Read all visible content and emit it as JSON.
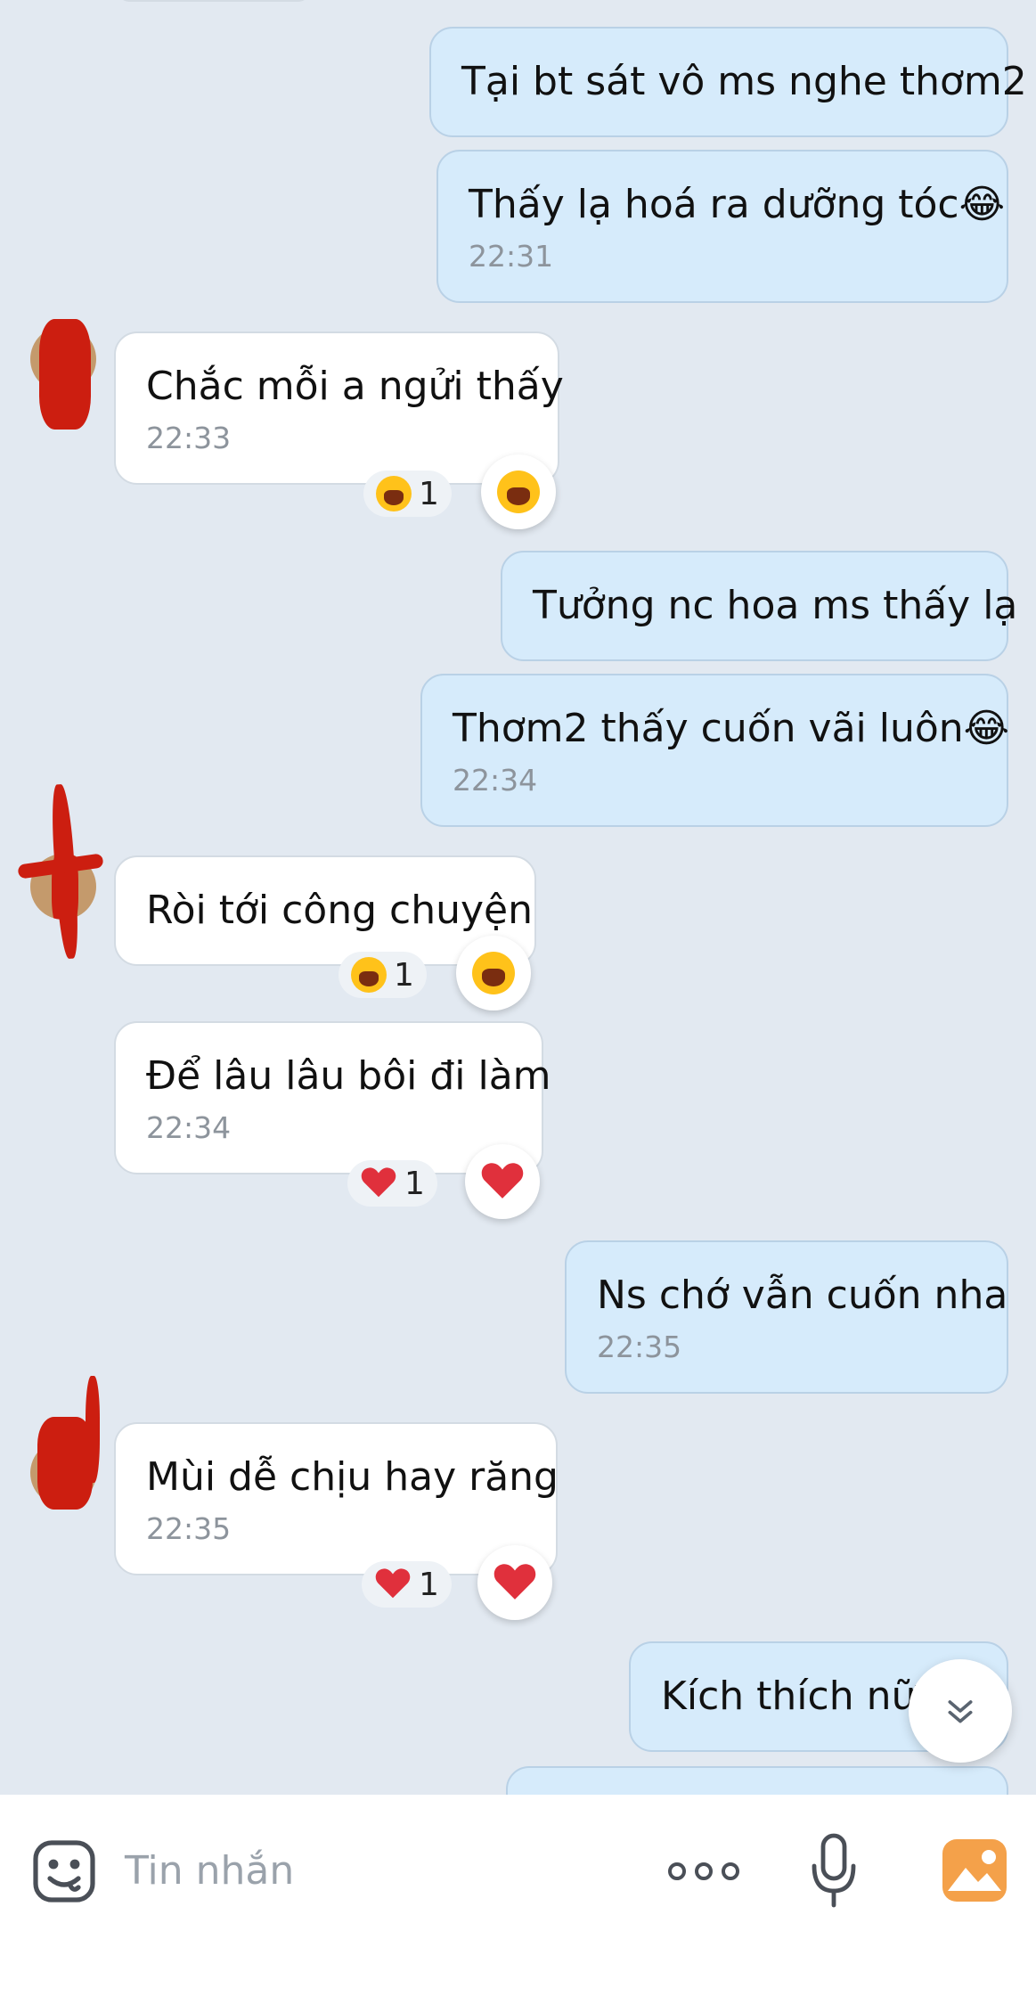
{
  "messages": [
    {
      "text": "Tại bt sát vô ms nghe thơm2",
      "time": ""
    },
    {
      "text": "Thấy lạ hoá ra dưỡng tóc😂",
      "time": "22:31"
    },
    {
      "text": "Chắc mỗi a ngửi thấy",
      "time": "22:33",
      "reaction_count": "1"
    },
    {
      "text": "Tưởng nc hoa ms thấy lạ",
      "time": ""
    },
    {
      "text": "Thơm2 thấy cuốn vãi luôn😂",
      "time": "22:34"
    },
    {
      "text": "Ròi tới công chuyện",
      "time": "",
      "reaction_count": "1"
    },
    {
      "text": "Để lâu lâu bôi đi làm",
      "time": "22:34",
      "reaction_count": "1"
    },
    {
      "text": "Ns chớ vẫn cuốn nha",
      "time": "22:35"
    },
    {
      "text": "Mùi dễ chịu hay răng",
      "time": "22:35",
      "reaction_count": "1"
    },
    {
      "text": "Kích thích nữa",
      "time": ""
    }
  ],
  "composer": {
    "placeholder": "Tin nhắn"
  },
  "icons": {
    "sticker": "sticker-icon",
    "more": "more-dots-icon",
    "mic": "microphone-icon",
    "photo": "photo-icon",
    "scroll_down": "chevron-double-down-icon",
    "laugh": "laughing-emoji-icon",
    "heart": "heart-emoji-icon"
  },
  "colors": {
    "background": "#e2e9f1",
    "outgoing_bubble": "#d6ebfb",
    "incoming_bubble": "#ffffff",
    "time_text": "#8d949c",
    "photo_icon": "#f4a14a",
    "heart": "#e0303c",
    "laugh": "#ffc21a"
  }
}
